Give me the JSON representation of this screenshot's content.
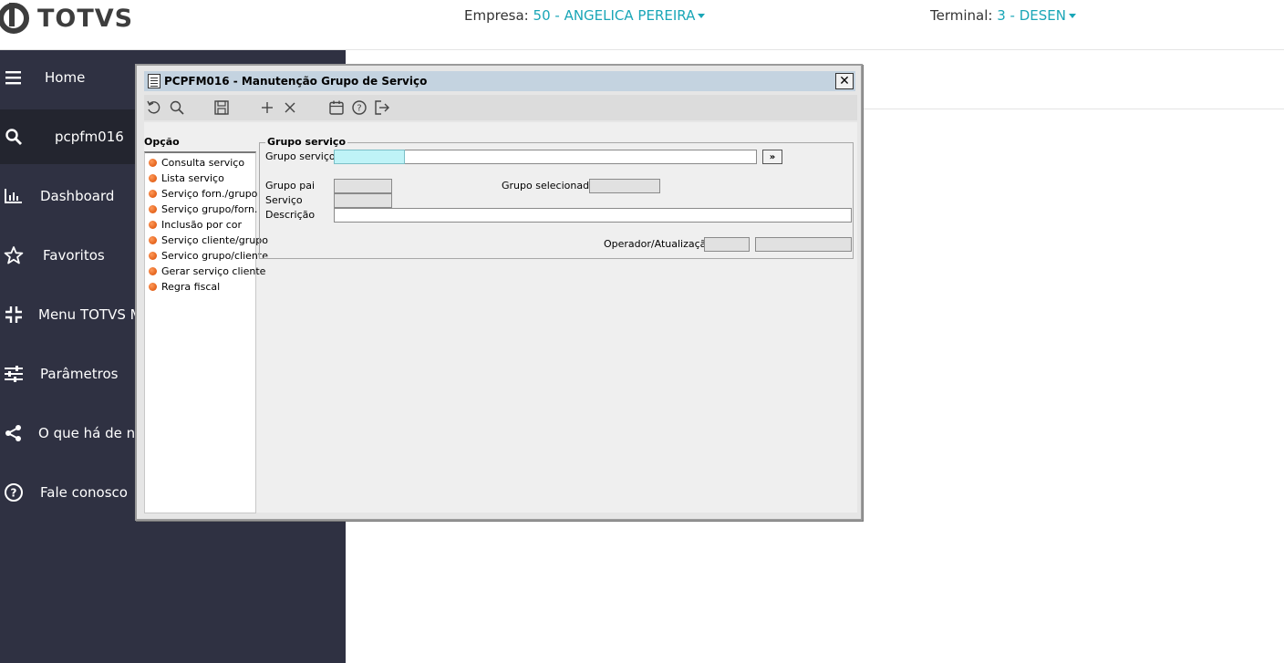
{
  "header": {
    "logo_text": "TOTVS",
    "company_label": "Empresa:",
    "company_value": "50 - ANGELICA PEREIRA",
    "terminal_label": "Terminal:",
    "terminal_value": "3 - DESEN"
  },
  "sidebar": {
    "items": [
      {
        "label": "Home",
        "icon": "menu-icon"
      },
      {
        "label": "pcpfm016",
        "icon": "search-icon"
      },
      {
        "label": "Dashboard",
        "icon": "bar-chart-icon"
      },
      {
        "label": "Favoritos",
        "icon": "star-icon"
      },
      {
        "label": "Menu TOTVS M",
        "icon": "compress-icon"
      },
      {
        "label": "Parâmetros",
        "icon": "sliders-icon"
      },
      {
        "label": "O que há de no",
        "icon": "share-icon"
      },
      {
        "label": "Fale conosco",
        "icon": "help-circle-icon"
      }
    ]
  },
  "window": {
    "title": "PCPFM016 - Manutenção Grupo de Serviço",
    "close_label": "✕",
    "toolbar_icons": [
      "undo-icon",
      "search-icon",
      "save-icon",
      "add-icon",
      "delete-icon",
      "calendar-icon",
      "help-icon",
      "exit-icon"
    ],
    "options_title": "Opção",
    "options": [
      "Consulta serviço",
      "Lista serviço",
      "Serviço forn./grupo",
      "Serviço grupo/forn.",
      "Inclusão por cor",
      "Serviço cliente/grupo",
      "Servico grupo/cliente",
      "Gerar serviço cliente",
      "Regra fiscal"
    ],
    "group": {
      "legend": "Grupo serviço",
      "grupo_servico_label": "Grupo serviço",
      "grupo_servico_value": "",
      "grupo_servico_desc": "",
      "more_button": "»",
      "grupo_pai_label": "Grupo pai",
      "grupo_pai_value": "",
      "grupo_selecionado_label": "Grupo selecionado",
      "grupo_selecionado_value": "",
      "servico_label": "Serviço",
      "servico_value": "",
      "descricao_label": "Descrição",
      "descricao_value": "",
      "operador_label": "Operador/Atualização",
      "operador_value": "",
      "atualizacao_value": ""
    }
  }
}
